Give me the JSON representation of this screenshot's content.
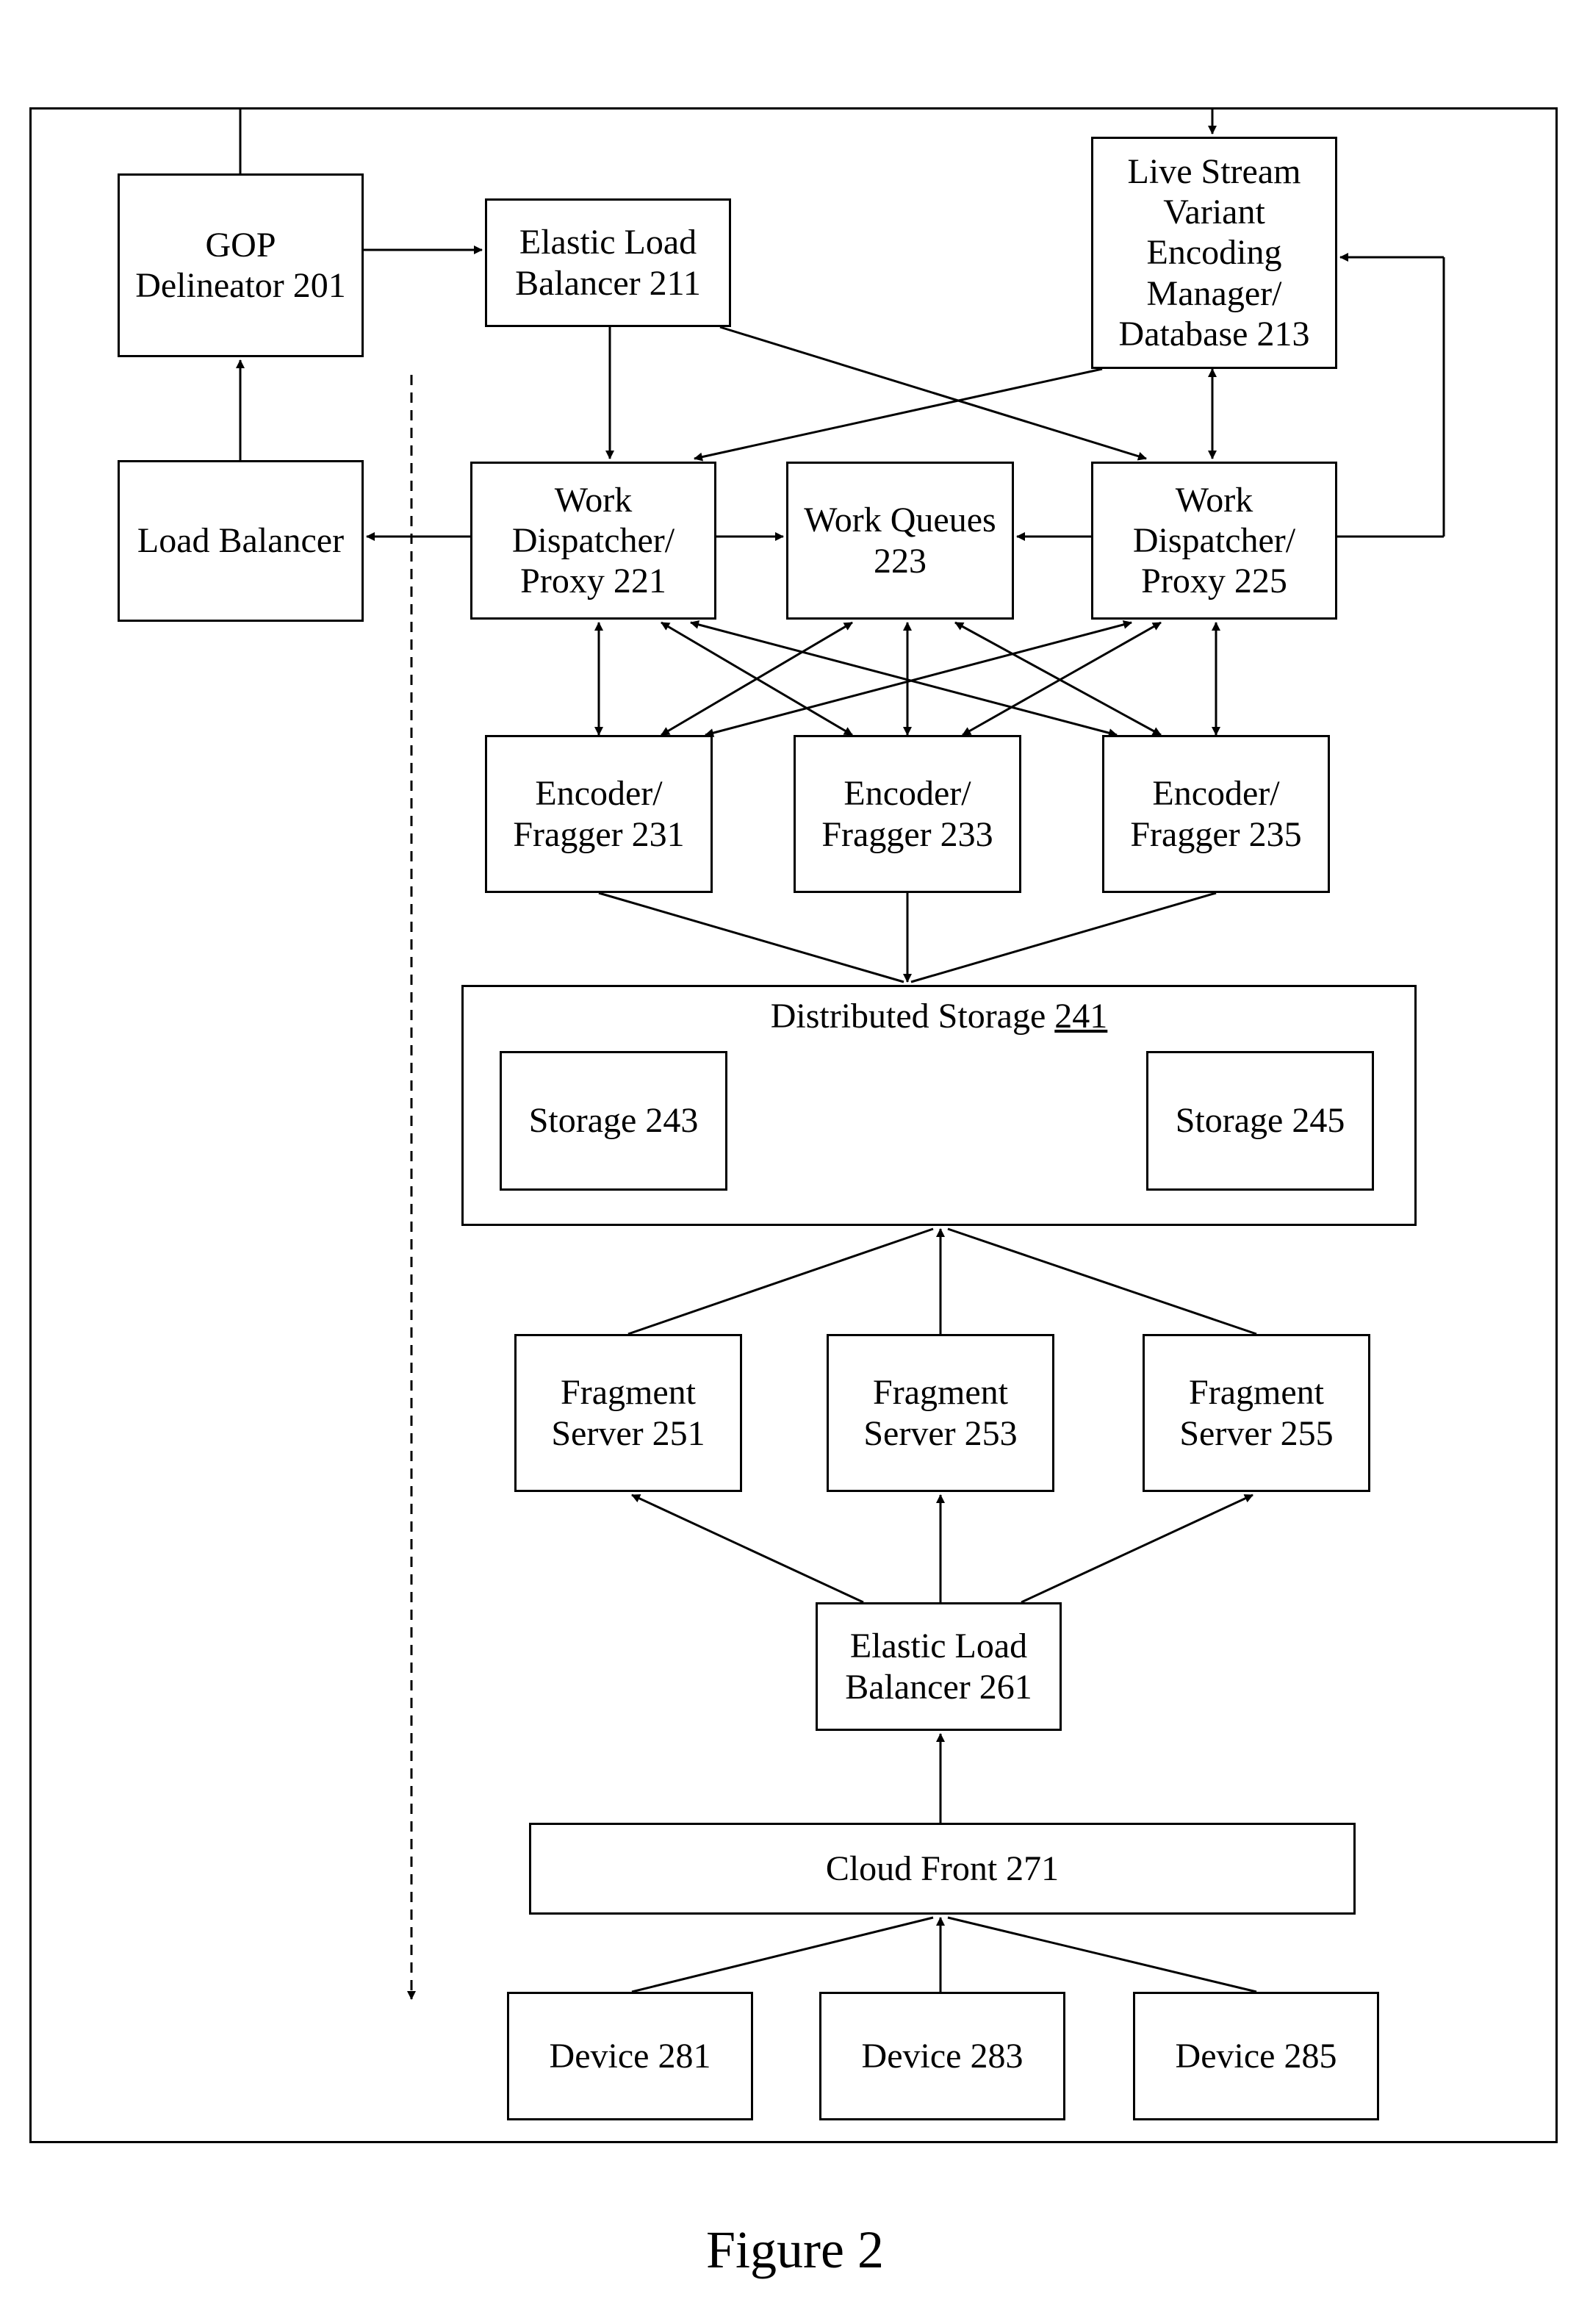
{
  "figure_caption": "Figure 2",
  "nodes": {
    "gop_delineator": "GOP Delineator 201",
    "load_balancer": "Load Balancer",
    "elb_top": "Elastic Load Balancer 211",
    "lsvem": "Live Stream Variant Encoding Manager/ Database 213",
    "wdp_left": "Work Dispatcher/ Proxy 221",
    "work_queues": "Work Queues 223",
    "wdp_right": "Work Dispatcher/ Proxy 225",
    "enc1": "Encoder/ Fragger 231",
    "enc2": "Encoder/ Fragger 233",
    "enc3": "Encoder/ Fragger 235",
    "dist_storage_label": "Distributed Storage ",
    "dist_storage_num": "241",
    "storage1": "Storage 243",
    "storage2": "Storage 245",
    "frag1": "Fragment Server 251",
    "frag2": "Fragment Server 253",
    "frag3": "Fragment Server 255",
    "elb_bottom": "Elastic Load Balancer 261",
    "cloud_front": "Cloud Front 271",
    "dev1": "Device 281",
    "dev2": "Device 283",
    "dev3": "Device 285"
  }
}
